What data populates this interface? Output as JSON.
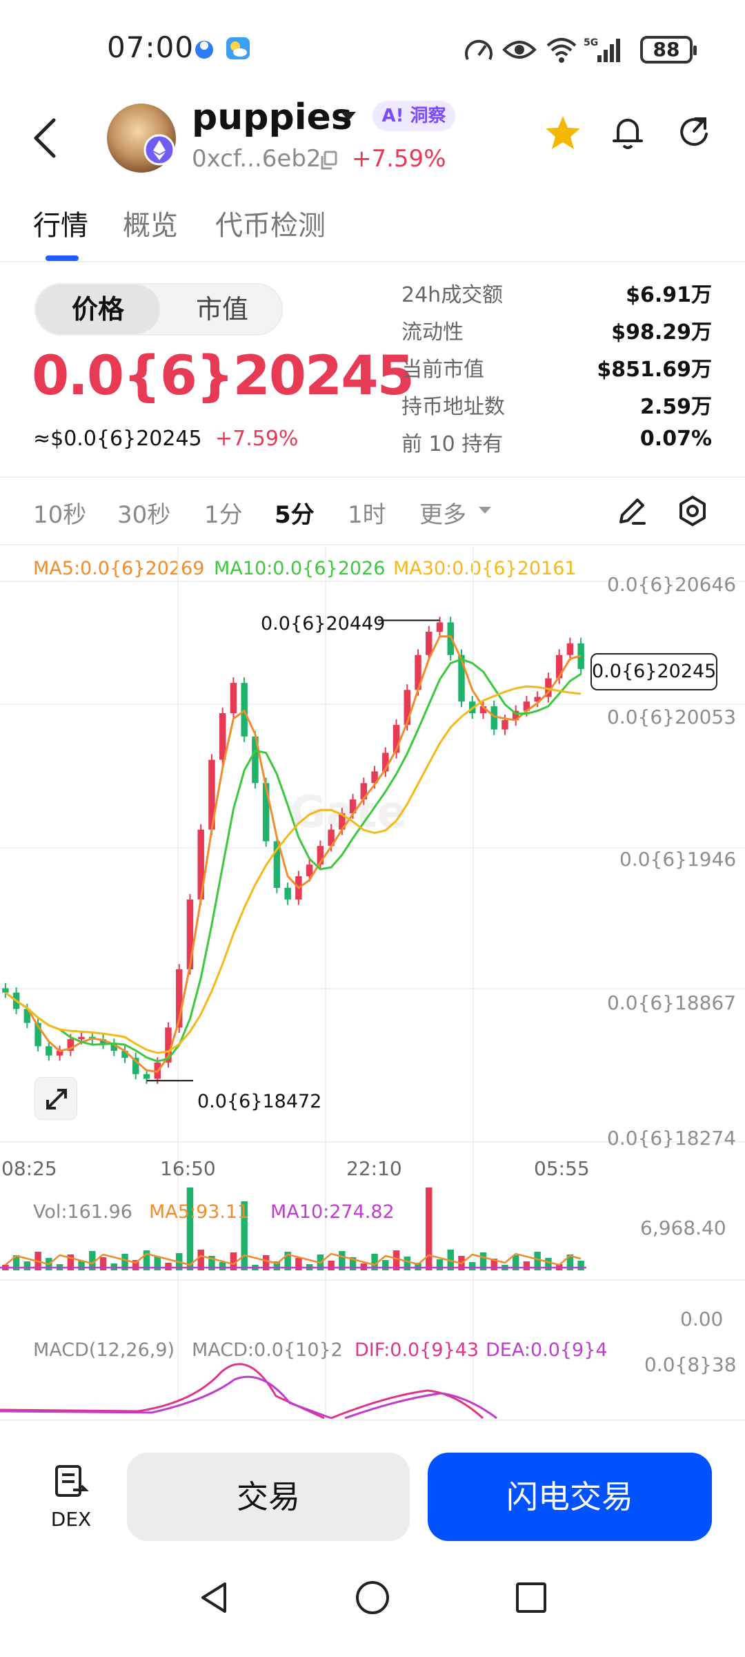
{
  "status": {
    "time": "07:00",
    "battery": "88",
    "network": "5G"
  },
  "header": {
    "token_name": "puppies",
    "ai_label": "A! 洞察",
    "address": "0xcf...6eb2",
    "change": "+7.59%",
    "accent_up": "#e63a55",
    "brand_blue": "#0052ff"
  },
  "tabs": [
    {
      "label": "行情",
      "active": true
    },
    {
      "label": "概览",
      "active": false
    },
    {
      "label": "代币检测",
      "active": false
    }
  ],
  "price_panel": {
    "toggle_on": "价格",
    "toggle_off": "市值",
    "price": "0.0{6}20245",
    "usd_price": "≈$0.0{6}20245",
    "usd_change": "+7.59%",
    "stats": [
      {
        "label": "24h成交额",
        "value": "$6.91万"
      },
      {
        "label": "流动性",
        "value": "$98.29万"
      },
      {
        "label": "当前市值",
        "value": "$851.69万"
      },
      {
        "label": "持币地址数",
        "value": "2.59万"
      },
      {
        "label": "前 10 持有",
        "value": "0.07%"
      }
    ]
  },
  "intervals": [
    {
      "label": "10秒",
      "active": false
    },
    {
      "label": "30秒",
      "active": false
    },
    {
      "label": "1分",
      "active": false
    },
    {
      "label": "5分",
      "active": true
    },
    {
      "label": "1时",
      "active": false
    },
    {
      "label": "更多",
      "active": false
    }
  ],
  "chart_ma": {
    "ma5": "MA5:0.0{6}20269",
    "ma10": "MA10:0.0{6}2026",
    "ma30": "MA30:0.0{6}20161",
    "ma5_color": "#f08c2e",
    "ma10_color": "#3cc83c",
    "ma30_color": "#f4b81a"
  },
  "chart_axis": {
    "y_labels": [
      "0.0{6}20646",
      "0.0{6}20053",
      "0.0{6}1946",
      "0.0{6}18867",
      "0.0{6}18274"
    ],
    "x_labels": [
      "08:25",
      "16:50",
      "22:10",
      "05:55"
    ],
    "current_price": "0.0{6}20245",
    "high_label": "0.0{6}20449",
    "low_label": "0.0{6}18472",
    "watermark": "Gate"
  },
  "volume": {
    "vol": "Vol:161.96",
    "ma5": "MA5:93.11",
    "ma10": "MA10:274.82",
    "max": "6,968.40",
    "min": "0.00"
  },
  "macd": {
    "title": "MACD(12,26,9)",
    "macd": "MACD:0.0{10}2",
    "dif": "DIF:0.0{9}43",
    "dea": "DEA:0.0{9}4",
    "max": "0.0{8}38"
  },
  "bottom": {
    "dex_label": "DEX",
    "trade_label": "交易",
    "flash_label": "闪电交易"
  },
  "chart_data": {
    "type": "candlestick",
    "interval": "5分",
    "x_ticks": [
      "08:25",
      "16:50",
      "22:10",
      "05:55"
    ],
    "y_ticks": [
      "0.0{6}20646",
      "0.0{6}20053",
      "0.0{6}1946",
      "0.0{6}18867",
      "0.0{6}18274"
    ],
    "ylim": [
      1.8274e-07,
      2.0646e-07
    ],
    "high": 2.0449e-07,
    "low": 1.8472e-07,
    "last": 2.0245e-07,
    "close_series": [
      1.885e-07,
      1.878e-07,
      1.872e-07,
      1.862e-07,
      1.858e-07,
      1.86e-07,
      1.865e-07,
      1.866e-07,
      1.865e-07,
      1.863e-07,
      1.86e-07,
      1.857e-07,
      1.85e-07,
      1.848e-07,
      1.855e-07,
      1.87e-07,
      1.895e-07,
      1.925e-07,
      1.955e-07,
      1.985e-07,
      2.005e-07,
      2.018e-07,
      1.995e-07,
      1.975e-07,
      1.95e-07,
      1.93e-07,
      1.925e-07,
      1.935e-07,
      1.94e-07,
      1.948e-07,
      1.955e-07,
      1.962e-07,
      1.968e-07,
      1.975e-07,
      1.98e-07,
      1.988e-07,
      2e-07,
      2.015e-07,
      2.03e-07,
      2.04e-07,
      2.044e-07,
      2.03e-07,
      2.01e-07,
      2.005e-07,
      2.008e-07,
      1.998e-07,
      2.002e-07,
      2.006e-07,
      2.01e-07,
      2.012e-07,
      2.02e-07,
      2.03e-07,
      2.035e-07,
      2.024e-07
    ]
  }
}
